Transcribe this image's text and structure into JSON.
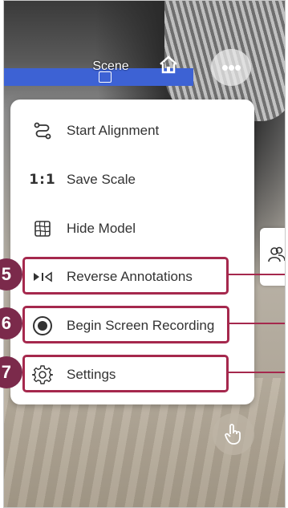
{
  "header": {
    "scene_label": "Scene",
    "more_label": "•••"
  },
  "menu": {
    "items": [
      {
        "label": "Start Alignment",
        "icon": "alignment-path-icon"
      },
      {
        "label": "Save Scale",
        "icon": "scale-ratio-icon",
        "icon_text": "1:1"
      },
      {
        "label": "Hide Model",
        "icon": "mesh-model-icon"
      },
      {
        "label": "Reverse Annotations",
        "icon": "reverse-annotations-icon"
      },
      {
        "label": "Begin Screen Recording",
        "icon": "record-icon"
      },
      {
        "label": "Settings",
        "icon": "gear-icon"
      }
    ]
  },
  "callouts": [
    {
      "number": "5"
    },
    {
      "number": "6"
    },
    {
      "number": "7"
    }
  ],
  "colors": {
    "highlight": "#a5284d",
    "badge": "#7b2a4b",
    "scene_bar": "#3d62d4"
  }
}
